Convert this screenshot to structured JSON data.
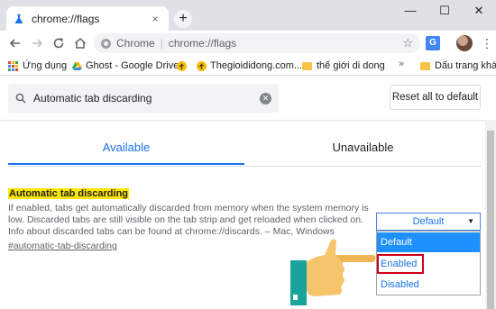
{
  "browser": {
    "tab_title": "chrome://flags",
    "new_tab_symbol": "+",
    "tab_close_symbol": "×",
    "window_controls": [
      "—",
      "☐",
      "✕"
    ],
    "address": {
      "scheme_label": "Chrome",
      "separator": "|",
      "url": "chrome://flags"
    }
  },
  "bookmarks": [
    {
      "label": "Ứng dụng",
      "icon": "apps-icon"
    },
    {
      "label": "Ghost - Google Drive",
      "icon": "drive-icon"
    },
    {
      "label": "",
      "icon": "runner-icon"
    },
    {
      "label": "Thegioididong.com...",
      "icon": "runner-icon"
    },
    {
      "label": "thế giới di dong",
      "icon": "folder-icon"
    },
    {
      "label": "Dấu trang khác",
      "icon": "folder-icon"
    }
  ],
  "bookmarks_more": "»",
  "flags_page": {
    "search_value": "Automatic tab discarding",
    "reset_label": "Reset all to default",
    "tabs": [
      "Available",
      "Unavailable"
    ],
    "active_tab": "Available",
    "flag": {
      "name": "Automatic tab discarding",
      "description": "If enabled, tabs get automatically discarded from memory when the system memory is low. Discarded tabs are still visible on the tab strip and get reloaded when clicked on. Info about discarded tabs can be found at chrome://discards. – Mac, Windows",
      "link": "#automatic-tab-discarding"
    },
    "select": {
      "current": "Default",
      "caret": "▼",
      "options": [
        "Default",
        "Enabled",
        "Disabled"
      ],
      "highlighted": "Default",
      "boxed": "Enabled"
    }
  },
  "colors": {
    "accent": "#1a73e8",
    "highlight": "#ffe600",
    "box": "#d0021b",
    "hand_skin": "#f5c46b",
    "hand_sleeve": "#1aa39b"
  }
}
